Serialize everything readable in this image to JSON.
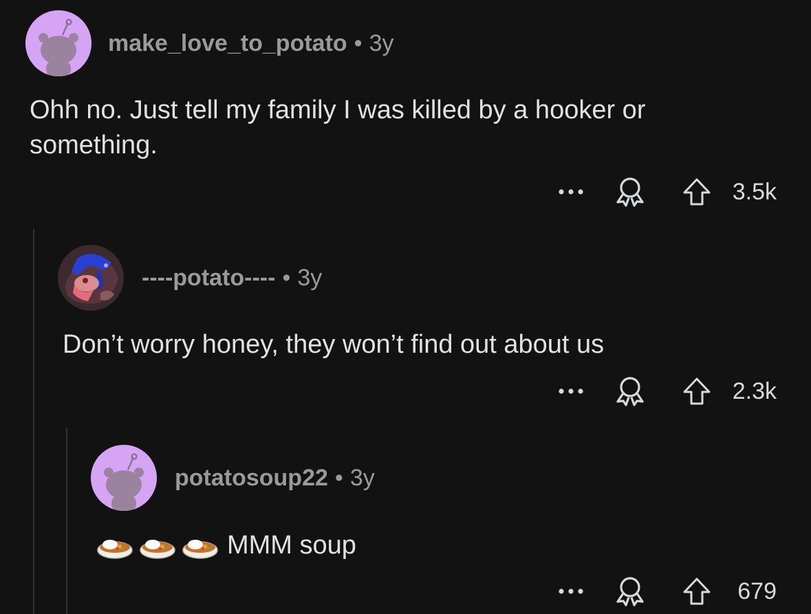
{
  "colors": {
    "background": "#121213",
    "text_primary": "#e0e2e4",
    "text_muted": "#9a9a9c",
    "thread_line": "#343536",
    "avatar_bg": "#d6a4f5"
  },
  "comments": [
    {
      "username": "make_love_to_potato",
      "separator": "•",
      "age": "3y",
      "avatar": "snoo-default-avatar",
      "body": "Ohh no. Just tell my family I was killed by a hooker or something.",
      "more_icon": "more-dots-icon",
      "award_icon": "award-icon",
      "upvote_icon": "upvote-arrow-icon",
      "score": "3.5k"
    },
    {
      "username": "----potato----",
      "separator": "•",
      "age": "3y",
      "avatar": "custom-art-avatar",
      "body": "Don’t worry honey, they won’t find out about us",
      "more_icon": "more-dots-icon",
      "award_icon": "award-icon",
      "upvote_icon": "upvote-arrow-icon",
      "score": "2.3k"
    },
    {
      "username": "potatosoup22",
      "separator": "•",
      "age": "3y",
      "avatar": "snoo-default-avatar",
      "emojis": [
        "curry-rice-emoji",
        "curry-rice-emoji",
        "curry-rice-emoji"
      ],
      "body": "MMM soup",
      "more_icon": "more-dots-icon",
      "award_icon": "award-icon",
      "upvote_icon": "upvote-arrow-icon",
      "score": "679"
    }
  ]
}
